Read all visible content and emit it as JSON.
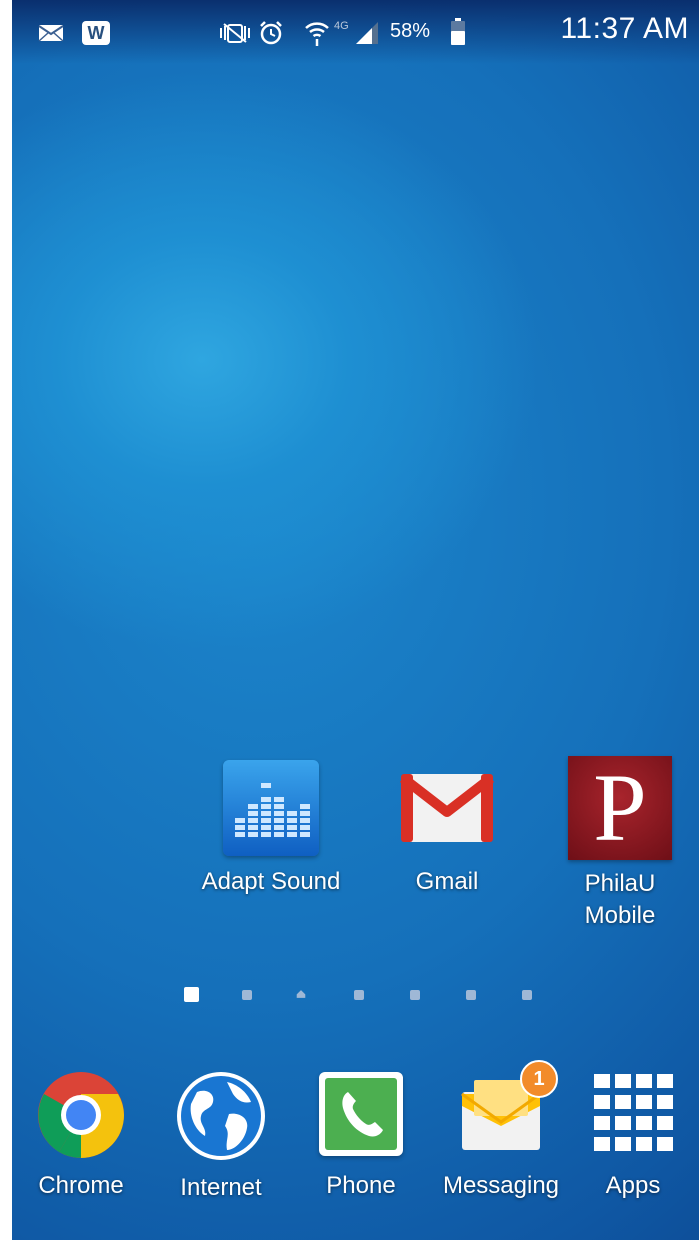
{
  "status_bar": {
    "battery_percent": "58%",
    "time": "11:37 AM",
    "network": "4G",
    "icons": [
      "mail-icon",
      "w-app-icon",
      "vibrate-icon",
      "alarm-icon",
      "wifi-icon",
      "signal-icon",
      "battery-icon"
    ],
    "notif_w_letter": "W"
  },
  "home_apps": [
    {
      "label": "Adapt Sound",
      "icon": "equalizer-icon"
    },
    {
      "label": "Gmail",
      "icon": "gmail-envelope-icon"
    },
    {
      "label": "PhilaU\nMobile",
      "icon": "philau-logo-icon",
      "logo_letter": "P"
    }
  ],
  "page_indicator": {
    "count": 7,
    "active_index": 0,
    "home_index": 2
  },
  "dock": [
    {
      "label": "Chrome",
      "icon": "chrome-icon"
    },
    {
      "label": "Internet",
      "icon": "globe-icon"
    },
    {
      "label": "Phone",
      "icon": "phone-handset-icon"
    },
    {
      "label": "Messaging",
      "icon": "envelope-icon",
      "badge": "1"
    },
    {
      "label": "Apps",
      "icon": "apps-grid-icon"
    }
  ]
}
